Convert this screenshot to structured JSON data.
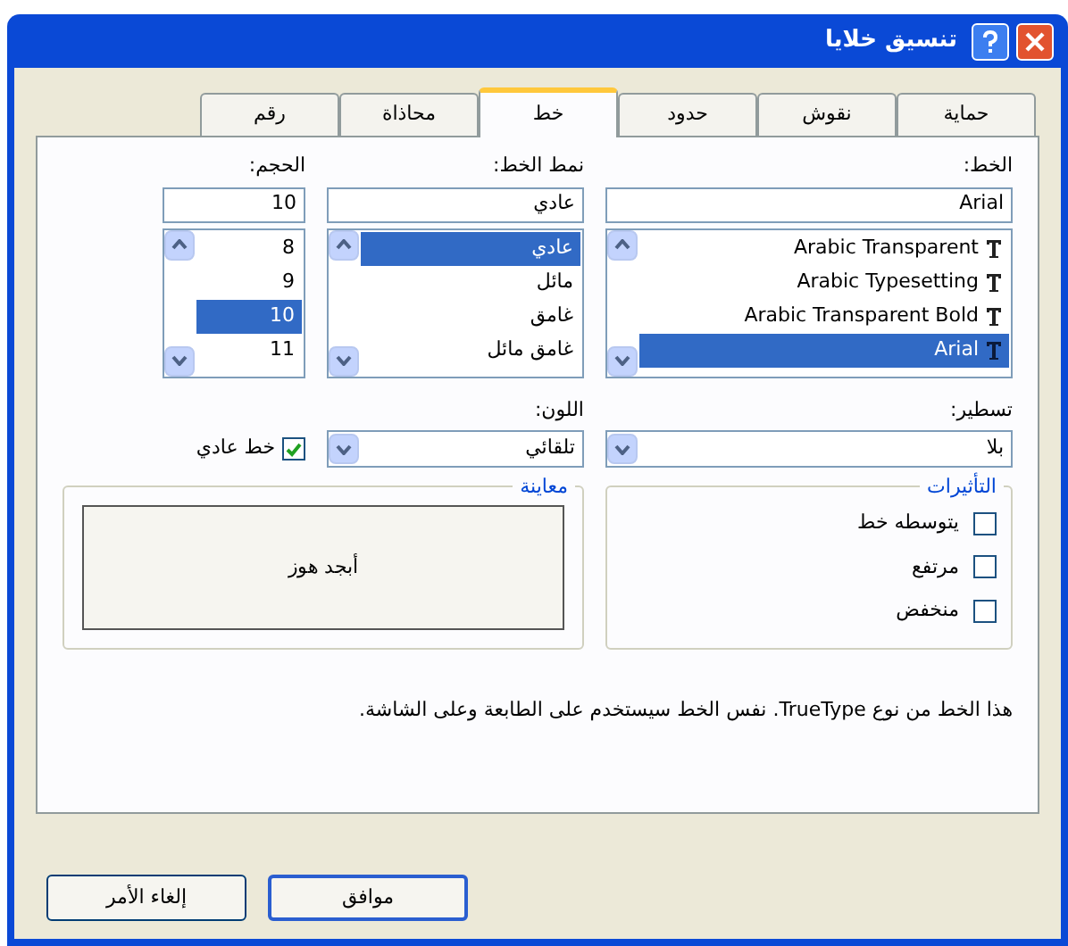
{
  "window": {
    "title": "تنسيق خلايا"
  },
  "tabs": [
    {
      "label": "حماية",
      "selected": false
    },
    {
      "label": "نقوش",
      "selected": false
    },
    {
      "label": "حدود",
      "selected": false
    },
    {
      "label": "خط",
      "selected": true
    },
    {
      "label": "محاذاة",
      "selected": false
    },
    {
      "label": "رقم",
      "selected": false
    }
  ],
  "lists": [
    {
      "label": "الخط:",
      "value": "Arial",
      "items": [
        {
          "label": "Arabic Transparent",
          "selected": false
        },
        {
          "label": "Arabic Typesetting",
          "selected": false
        },
        {
          "label": "Arabic Transparent Bold",
          "selected": false
        },
        {
          "label": "Arial",
          "selected": true
        }
      ]
    },
    {
      "label": "نمط الخط:",
      "value": "عادي",
      "items": [
        {
          "label": "عادي",
          "selected": true
        },
        {
          "label": "مائل",
          "selected": false
        },
        {
          "label": "غامق",
          "selected": false
        },
        {
          "label": "غامق مائل",
          "selected": false
        }
      ]
    },
    {
      "label": "الحجم:",
      "value": "10",
      "items": [
        {
          "label": "8",
          "selected": false
        },
        {
          "label": "9",
          "selected": false
        },
        {
          "label": "10",
          "selected": true
        },
        {
          "label": "11",
          "selected": false
        }
      ]
    }
  ],
  "underline": {
    "label": "تسطير:",
    "value": "بلا"
  },
  "color": {
    "label": "اللون:",
    "value": "تلقائي"
  },
  "normal_font": {
    "label": "خط عادي",
    "checked": true
  },
  "effects": {
    "title": "التأثيرات",
    "items": [
      {
        "label": "يتوسطه خط",
        "checked": false
      },
      {
        "label": "مرتفع",
        "checked": false
      },
      {
        "label": "منخفض",
        "checked": false
      }
    ]
  },
  "preview": {
    "title": "معاينة",
    "sample": "أبجد هوز"
  },
  "note": "هذا الخط من نوع TrueType. نفس الخط سيستخدم على الطابعة وعلى الشاشة.",
  "buttons": [
    "موافق",
    "إلغاء الأمر"
  ]
}
